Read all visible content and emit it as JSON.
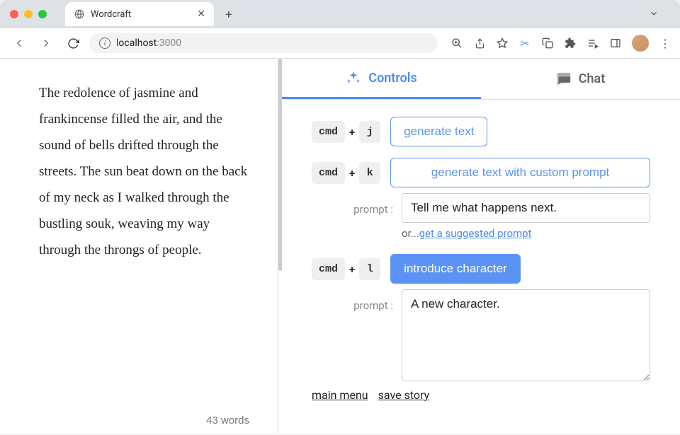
{
  "browser": {
    "tab_title": "Wordcraft",
    "url_host": "localhost",
    "url_port": ":3000"
  },
  "editor": {
    "text": " The redolence of jasmine and frankincense filled the air, and the sound of bells drifted through the streets. The sun beat down on the back of my neck as I walked through the bustling souk, weaving my way through the throngs of people.",
    "word_count": "43 words"
  },
  "tabs": {
    "controls_label": "Controls",
    "chat_label": "Chat"
  },
  "controls": [
    {
      "key1": "cmd",
      "plus": "+",
      "key2": "j",
      "button_label": "generate text"
    },
    {
      "key1": "cmd",
      "plus": "+",
      "key2": "k",
      "button_label": "generate text with custom prompt",
      "prompt_label": "prompt :",
      "prompt_value": "Tell me what happens next.",
      "hint_prefix": "or...",
      "hint_link": "get a suggested prompt"
    },
    {
      "key1": "cmd",
      "plus": "+",
      "key2": "l",
      "button_label": "introduce character",
      "prompt_label": "prompt :",
      "prompt_value": "A new character."
    }
  ],
  "footer": {
    "main_menu": "main menu",
    "save_story": "save story"
  }
}
